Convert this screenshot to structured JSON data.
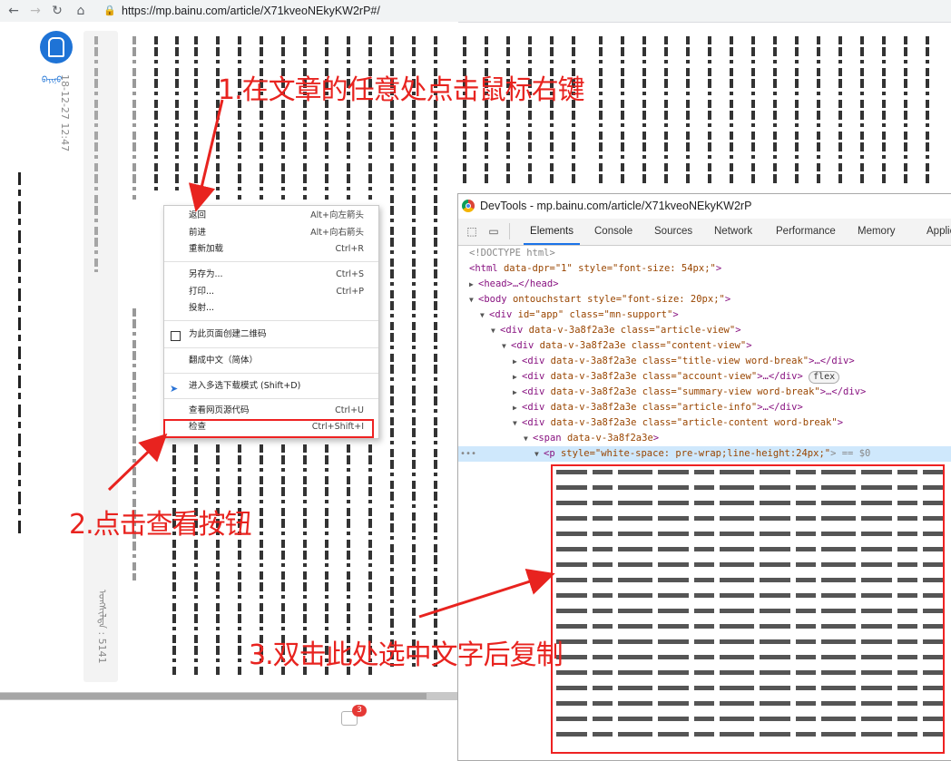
{
  "browser": {
    "url": "https://mp.bainu.com/article/X71kveoNEkyKW2rP#/"
  },
  "article": {
    "author_label": "ᠪᠠᠶᠢᠨᠤ",
    "date": "18-12-27 12:47",
    "views": "ᠤᠩᠰᠢᠯᠳᠠ : 5141",
    "comment_count": "3"
  },
  "context_menu": {
    "items": [
      {
        "label": "返回",
        "shortcut": "Alt+向左箭头"
      },
      {
        "label": "前进",
        "shortcut": "Alt+向右箭头"
      },
      {
        "label": "重新加载",
        "shortcut": "Ctrl+R"
      },
      {
        "label": "另存为...",
        "shortcut": "Ctrl+S"
      },
      {
        "label": "打印...",
        "shortcut": "Ctrl+P"
      },
      {
        "label": "投射...",
        "shortcut": ""
      },
      {
        "label": "为此页面创建二维码",
        "shortcut": ""
      },
      {
        "label": "翻成中文（简体）",
        "shortcut": ""
      },
      {
        "label": "进入多选下载模式 (Shift+D)",
        "shortcut": ""
      },
      {
        "label": "查看网页源代码",
        "shortcut": "Ctrl+U"
      },
      {
        "label": "检查",
        "shortcut": "Ctrl+Shift+I"
      }
    ]
  },
  "devtools": {
    "title": "DevTools - mp.bainu.com/article/X71kveoNEkyKW2rP",
    "tabs": [
      "Elements",
      "Console",
      "Sources",
      "Network",
      "Performance",
      "Memory",
      "Applica"
    ],
    "dom": [
      {
        "text": "<!DOCTYPE html>"
      },
      {
        "tag": "html",
        "attrs": " data-dpr=\"1\" style=\"font-size: 54px;\"",
        "tail": ">"
      },
      {
        "tag": "head",
        "tail": ">…</head>"
      },
      {
        "tag": "body",
        "attrs": " ontouchstart style=\"font-size: 20px;\"",
        "tail": ">"
      },
      {
        "tag": "div",
        "attrs": " id=\"app\" class=\"mn-support\"",
        "tail": ">"
      },
      {
        "tag": "div",
        "attrs": " data-v-3a8f2a3e class=\"article-view\"",
        "tail": ">"
      },
      {
        "tag": "div",
        "attrs": " data-v-3a8f2a3e class=\"content-view\"",
        "tail": ">"
      },
      {
        "tag": "div",
        "attrs": " data-v-3a8f2a3e class=\"title-view word-break\"",
        "tail": ">…</div>"
      },
      {
        "tag": "div",
        "attrs": " data-v-3a8f2a3e class=\"account-view\"",
        "tail": ">…</div>",
        "badge": "flex"
      },
      {
        "tag": "div",
        "attrs": " data-v-3a8f2a3e class=\"summary-view word-break\"",
        "tail": ">…</div>"
      },
      {
        "tag": "div",
        "attrs": " data-v-3a8f2a3e class=\"article-info\"",
        "tail": ">…</div>"
      },
      {
        "tag": "div",
        "attrs": " data-v-3a8f2a3e class=\"article-content word-break\"",
        "tail": ">"
      },
      {
        "tag": "span",
        "attrs": " data-v-3a8f2a3e",
        "tail": ">"
      },
      {
        "tag": "p",
        "attrs": " style=\"white-space: pre-wrap;line-height:24px;\"",
        "tail": "> == $0"
      }
    ]
  },
  "annotations": {
    "step1": "1.在文章的任意处点击鼠标右键",
    "step2": "2.点击查看按钮",
    "step3": "3.双击此处选中文字后复制"
  },
  "colors": {
    "annotation": "#e8231f",
    "devtools_accent": "#1a73e8",
    "selected_row": "#cfe8fc"
  }
}
